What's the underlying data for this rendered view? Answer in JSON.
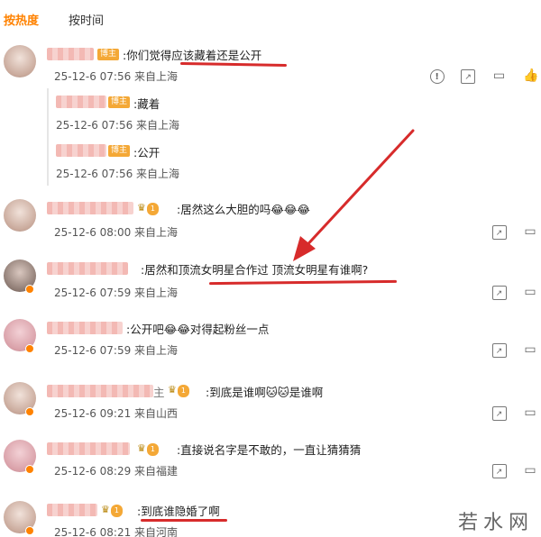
{
  "tabs": {
    "hot": "按热度",
    "time": "按时间"
  },
  "owner_label": "博主",
  "comments": [
    {
      "text": ":你们觉得应该藏着还是公开",
      "time": "25-12-6 07:56 来自上海",
      "replies": [
        {
          "text": ":藏着",
          "time": "25-12-6 07:56 来自上海"
        },
        {
          "text": ":公开",
          "time": "25-12-6 07:56 来自上海"
        }
      ]
    },
    {
      "text": ":居然这么大胆的吗😂😂😂",
      "time": "25-12-6 08:00 来自上海"
    },
    {
      "text": ":居然和顶流女明星合作过 顶流女明星有谁啊?",
      "time": "25-12-6 07:59 来自上海"
    },
    {
      "text": ":公开吧😂😂对得起粉丝一点",
      "time": "25-12-6 07:59 来自上海"
    },
    {
      "text": ":到底是谁啊🐱🐱是谁啊",
      "time": "25-12-6 09:21 来自山西"
    },
    {
      "text": ":直接说名字是不敢的，一直让猜猜猜",
      "time": "25-12-6 08:29 来自福建"
    },
    {
      "text": ":到底谁隐婚了啊",
      "time": "25-12-6 08:21 来自河南"
    }
  ],
  "badge_text": {
    "crown_level": "1",
    "partial_name": "主"
  },
  "watermark": "若水网",
  "colors": {
    "accent": "#ff8200",
    "annotation": "#d72b2b"
  }
}
